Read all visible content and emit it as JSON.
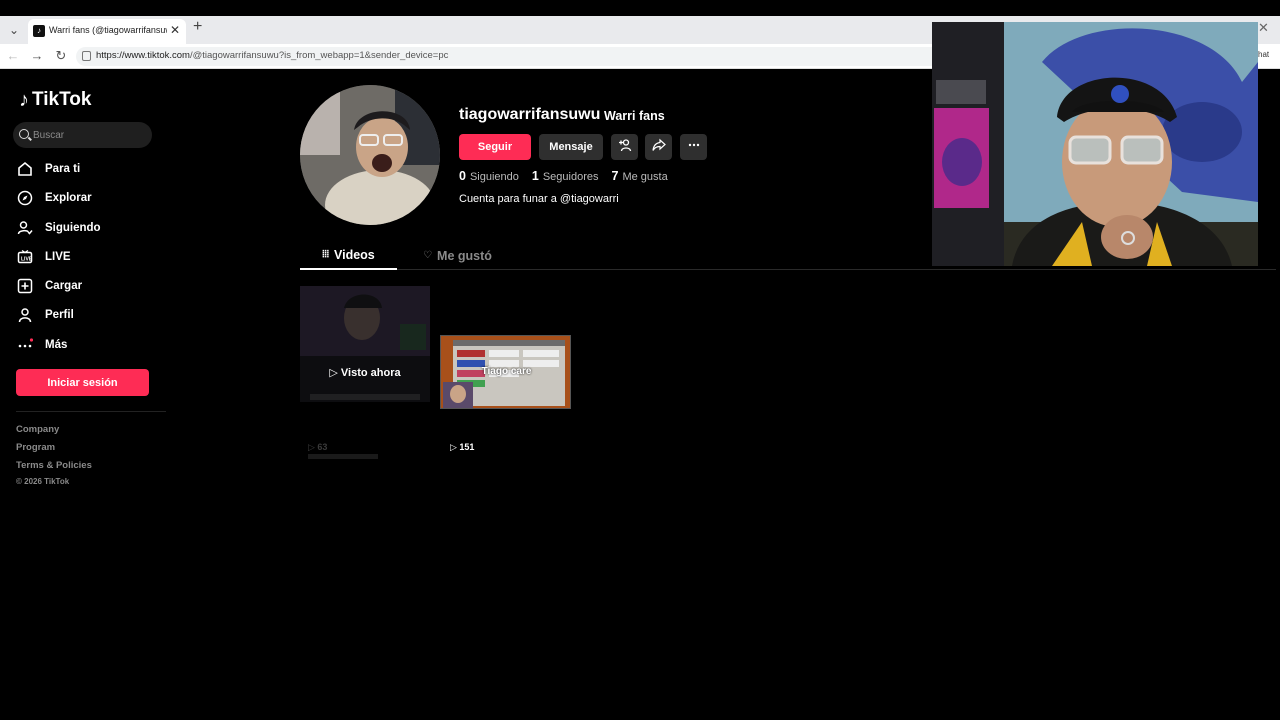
{
  "browser": {
    "tab_title": "Warri fans (@tiagowarrifansuwu) |",
    "url_host": "https://www.tiktok.com",
    "url_path": "/@tiagowarrifansuwu?is_from_webapp=1&sender_device=pc",
    "edge_fragment": "hat"
  },
  "sidebar": {
    "logo": "TikTok",
    "search_placeholder": "Buscar",
    "items": [
      {
        "label": "Para ti",
        "icon": "home-icon"
      },
      {
        "label": "Explorar",
        "icon": "compass-icon"
      },
      {
        "label": "Siguiendo",
        "icon": "following-icon"
      },
      {
        "label": "LIVE",
        "icon": "live-icon"
      },
      {
        "label": "Cargar",
        "icon": "upload-icon"
      },
      {
        "label": "Perfil",
        "icon": "profile-icon"
      },
      {
        "label": "Más",
        "icon": "more-icon"
      }
    ],
    "login_label": "Iniciar sesión",
    "footer": [
      "Company",
      "Program",
      "Terms & Policies"
    ],
    "copyright": "© 2026 TikTok"
  },
  "profile": {
    "username": "tiagowarrifansuwu",
    "nickname": "Warri fans",
    "follow_label": "Seguir",
    "message_label": "Mensaje",
    "stats": [
      {
        "value": "0",
        "label": "Siguiendo"
      },
      {
        "value": "1",
        "label": "Seguidores"
      },
      {
        "value": "7",
        "label": "Me gusta"
      }
    ],
    "bio": "Cuenta para funar a @tiagowarri"
  },
  "tabs": {
    "videos": "Videos",
    "liked": "Me gustó"
  },
  "videos": [
    {
      "overlay": "Visto ahora",
      "views": "63"
    },
    {
      "overlay": "Tiago care",
      "views": "151"
    }
  ],
  "colors": {
    "accent": "#fe2c55",
    "background": "#000000",
    "surface": "#2f2f2f"
  }
}
